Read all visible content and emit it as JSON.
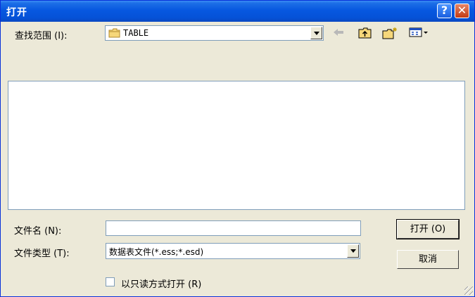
{
  "window": {
    "title": "打开",
    "help_glyph": "?",
    "close_glyph": "✕"
  },
  "lookin": {
    "label": "查找范围 (I):",
    "current": "TABLE"
  },
  "toolbar": {
    "icons": [
      "back-icon",
      "up-folder-icon",
      "new-folder-icon",
      "view-menu-icon"
    ]
  },
  "filename": {
    "label": "文件名 (N):",
    "value": ""
  },
  "filetype": {
    "label": "文件类型 (T):",
    "value": "数据表文件(*.ess;*.esd)"
  },
  "readonly": {
    "label": "以只读方式打开 (R)",
    "checked": false
  },
  "buttons": {
    "open": "打开 (O)",
    "cancel": "取消"
  },
  "colors": {
    "title_bar": "#0758e0",
    "face": "#ece9d8",
    "field_border": "#7f9db9"
  }
}
